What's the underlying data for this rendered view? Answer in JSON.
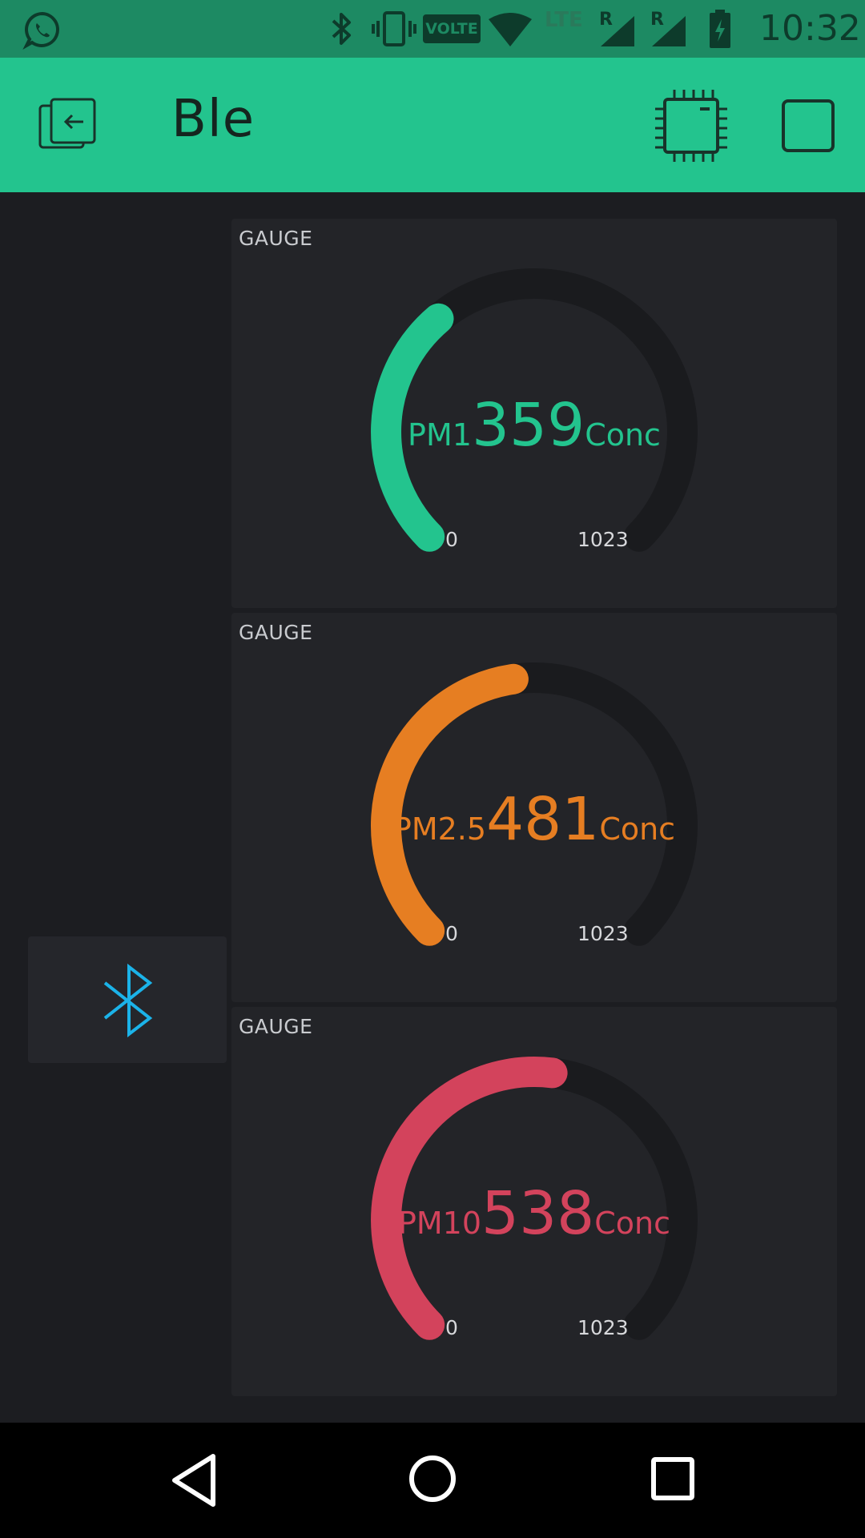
{
  "status_bar": {
    "time": "10:32",
    "volte_label": "VOLTE",
    "lte_label": "LTE",
    "roaming_1": "R",
    "roaming_2": "R",
    "icons": [
      "whatsapp-icon",
      "bluetooth-icon",
      "vibrate-icon",
      "volte-icon",
      "wifi-icon",
      "lte-icon",
      "signal-icon",
      "signal-icon",
      "battery-charging-icon"
    ]
  },
  "app_bar": {
    "title": "Ble",
    "icons": [
      "exit-icon",
      "device-chip-icon",
      "play-stop-icon"
    ]
  },
  "ble_widget": {
    "icon": "bluetooth-icon",
    "color": "#1bb3e9"
  },
  "gauges": [
    {
      "title": "GAUGE",
      "prefix": "PM1",
      "value": "359",
      "suffix": "Conc",
      "min": "0",
      "max": "1023",
      "level": 0.351,
      "color": "#23c48e"
    },
    {
      "title": "GAUGE",
      "prefix": "PM2.5",
      "value": "481",
      "suffix": "Conc",
      "min": "0",
      "max": "1023",
      "level": 0.47,
      "color": "#e67e22"
    },
    {
      "title": "GAUGE",
      "prefix": "PM10",
      "value": "538",
      "suffix": "Conc",
      "min": "0",
      "max": "1023",
      "level": 0.526,
      "color": "#d3435c"
    }
  ],
  "colors": {
    "accent": "#23c48e",
    "status_bar": "#1d8a63",
    "background": "#1c1d21",
    "card": "#232428",
    "gauge_track": "#1a1b1e"
  },
  "nav_bar": {
    "icons": [
      "back-icon",
      "home-icon",
      "recents-icon"
    ]
  }
}
